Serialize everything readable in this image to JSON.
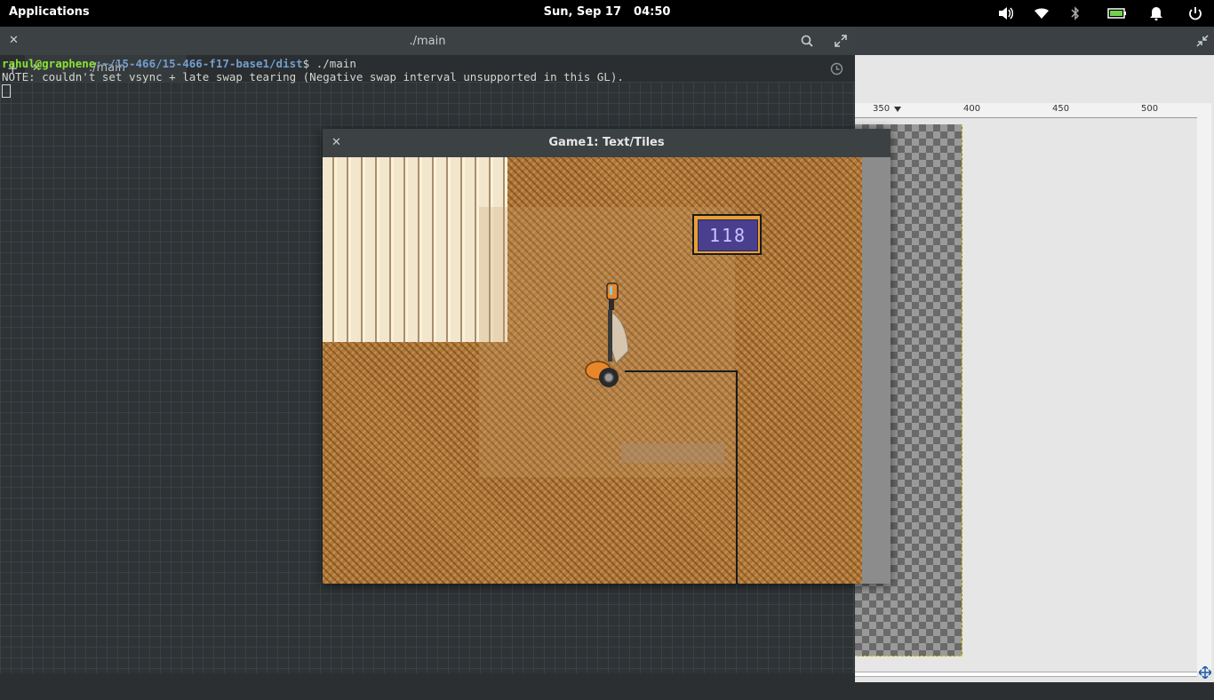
{
  "topbar": {
    "applications_label": "Applications",
    "date": "Sun, Sep 17",
    "time": "04:50",
    "icons": [
      "volume-icon",
      "wifi-icon",
      "bluetooth-icon",
      "battery-icon",
      "notification-bell-icon",
      "power-icon"
    ]
  },
  "gimp": {
    "ruler_labels": [
      "350",
      "400",
      "450",
      "500"
    ]
  },
  "terminal": {
    "title": "./main",
    "tab_label": "./main",
    "prompt_user": "rahul@graphene",
    "prompt_path": ":~/15-466/15-466-f17-base1/dist",
    "prompt_cmd": "$ ./main",
    "note_line": "NOTE: couldn't set vsync + late swap tearing (Negative swap interval unsupported in this GL)."
  },
  "game": {
    "title": "Game1: Text/Tiles",
    "sign_value": "118"
  },
  "colors": {
    "floor": "#b07838",
    "sign_frame": "#e8a032",
    "sign_screen": "#4a3e8e",
    "prompt_green": "#8ae234",
    "prompt_blue": "#729fcf"
  }
}
